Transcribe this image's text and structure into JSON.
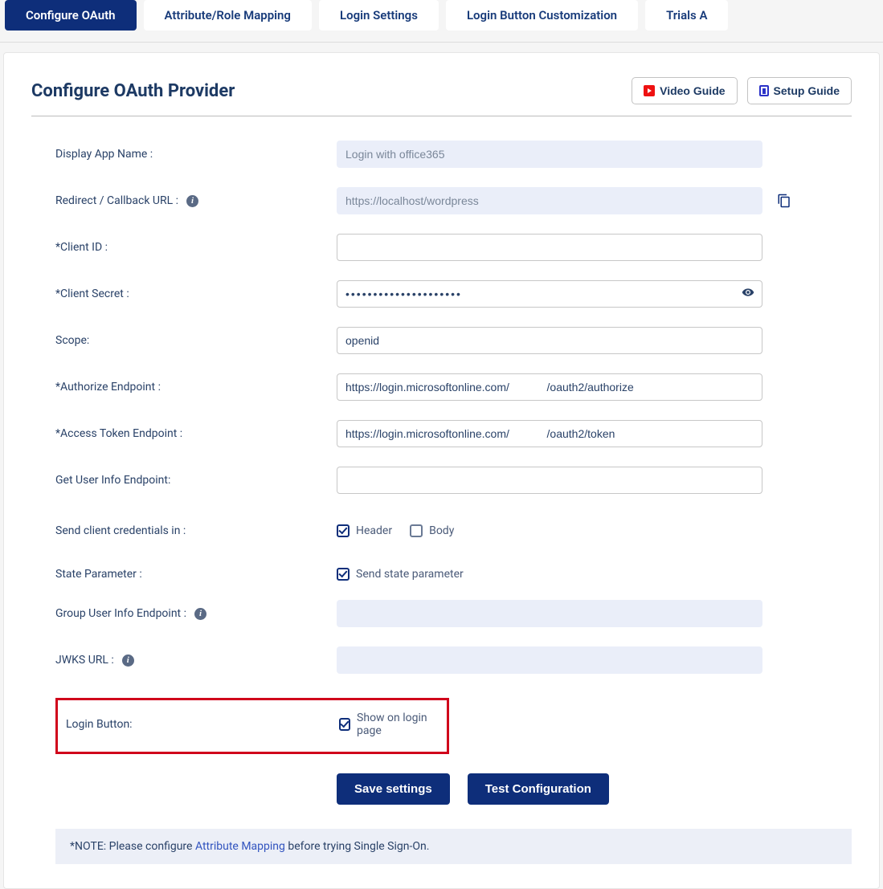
{
  "tabs": [
    {
      "label": "Configure OAuth",
      "active": true
    },
    {
      "label": "Attribute/Role Mapping",
      "active": false
    },
    {
      "label": "Login Settings",
      "active": false
    },
    {
      "label": "Login Button Customization",
      "active": false
    },
    {
      "label": "Trials A",
      "active": false
    }
  ],
  "page_title": "Configure OAuth Provider",
  "guides": {
    "video": "Video Guide",
    "setup": "Setup Guide"
  },
  "form": {
    "display_app_name": {
      "label": "Display App Name :",
      "value": "Login with office365"
    },
    "redirect_url": {
      "label": "Redirect / Callback URL :",
      "value": "https://localhost/wordpress"
    },
    "client_id": {
      "label": "*Client ID :",
      "value": ""
    },
    "client_secret": {
      "label": "*Client Secret :",
      "value": "•••••••••••••••••••••"
    },
    "scope": {
      "label": "Scope:",
      "value": "openid"
    },
    "authorize_endpoint": {
      "label": "*Authorize Endpoint :",
      "value": "https://login.microsoftonline.com/            /oauth2/authorize"
    },
    "access_token_endpoint": {
      "label": "*Access Token Endpoint :",
      "value": "https://login.microsoftonline.com/            /oauth2/token"
    },
    "userinfo_endpoint": {
      "label": "Get User Info Endpoint:",
      "value": ""
    },
    "send_credentials": {
      "label": "Send client credentials in :",
      "options": {
        "header": "Header",
        "body": "Body"
      }
    },
    "state_parameter": {
      "label": "State Parameter :",
      "option": "Send state parameter"
    },
    "group_userinfo_endpoint": {
      "label": "Group User Info Endpoint :",
      "value": ""
    },
    "jwks_url": {
      "label": "JWKS URL :",
      "value": ""
    },
    "login_button": {
      "label": "Login Button:",
      "option": "Show on login page"
    }
  },
  "buttons": {
    "save": "Save settings",
    "test": "Test Configuration"
  },
  "note": {
    "prefix": "*NOTE:  Please configure ",
    "link": "Attribute Mapping",
    "suffix": " before trying Single Sign-On."
  }
}
